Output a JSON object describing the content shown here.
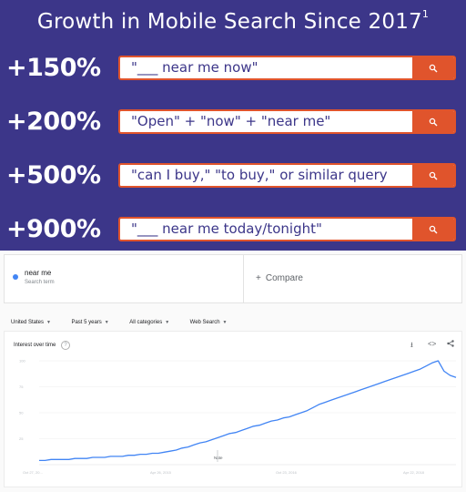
{
  "banner": {
    "title": "Growth in Mobile Search Since 2017",
    "footnote_mark": "1",
    "rows": [
      {
        "percent": "+150%",
        "query": "\"___ near me now\""
      },
      {
        "percent": "+200%",
        "query": "\"Open\" + \"now\" + \"near me\""
      },
      {
        "percent": "+500%",
        "query": "\"can I buy,\" \"to buy,\" or similar query"
      },
      {
        "percent": "+900%",
        "query": "\"___ near me today/tonight\""
      }
    ],
    "search_icon": "search-icon",
    "colors": {
      "background": "#3c3689",
      "accent": "#e0542c",
      "text": "#ffffff"
    }
  },
  "trends": {
    "term": {
      "name": "near me",
      "subtitle": "Search term",
      "color": "#4285f4"
    },
    "compare_label": "Compare",
    "filters": [
      "United States",
      "Past 5 years",
      "All categories",
      "Web Search"
    ],
    "chart_title": "Interest over time",
    "help_icon": "?",
    "note_label": "Note",
    "icons": [
      "download-icon",
      "embed-icon",
      "share-icon"
    ]
  },
  "chart_data": {
    "type": "line",
    "title": "Interest over time",
    "xlabel": "",
    "ylabel": "",
    "ylim": [
      0,
      100
    ],
    "yticks": [
      "100",
      "75",
      "50",
      "25"
    ],
    "xticks": [
      "Oct 27, 20...",
      "Apr 26, 2015",
      "Oct 23, 2016",
      "Apr 22, 2018"
    ],
    "grid": true,
    "series": [
      {
        "color": "#4285f4",
        "values": [
          4,
          4,
          5,
          5,
          5,
          5,
          6,
          6,
          6,
          7,
          7,
          7,
          8,
          8,
          8,
          9,
          9,
          10,
          10,
          11,
          11,
          12,
          13,
          14,
          16,
          17,
          19,
          21,
          22,
          24,
          26,
          28,
          30,
          31,
          33,
          35,
          37,
          38,
          40,
          42,
          43,
          45,
          46,
          48,
          50,
          52,
          55,
          58,
          60,
          62,
          64,
          66,
          68,
          70,
          72,
          74,
          76,
          78,
          80,
          82,
          84,
          86,
          88,
          90,
          92,
          95,
          98,
          100,
          90,
          86,
          84
        ]
      }
    ]
  }
}
